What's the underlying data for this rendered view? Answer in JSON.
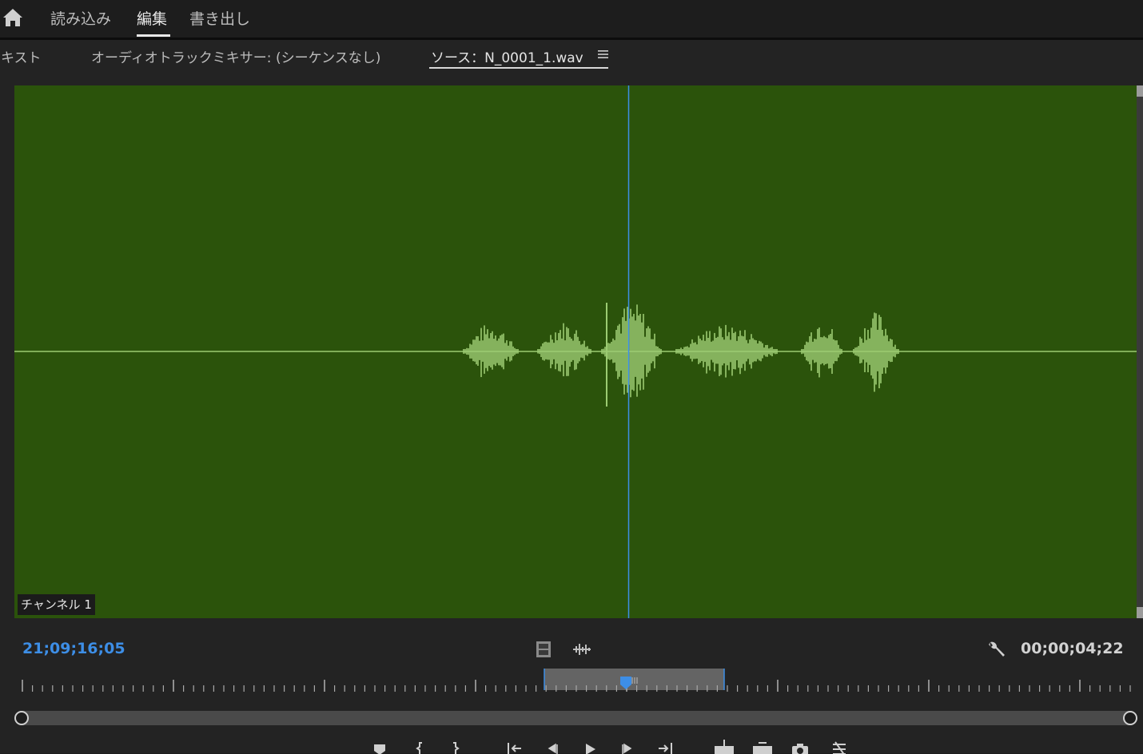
{
  "workspace_tabs": [
    {
      "label": "読み込み",
      "active": false
    },
    {
      "label": "編集",
      "active": true
    },
    {
      "label": "書き出し",
      "active": false
    }
  ],
  "panel_tabs": [
    {
      "label": "テキスト",
      "active": false
    },
    {
      "label": "オーディオトラックミキサー: (シーケンスなし)",
      "active": false
    },
    {
      "label": "ソース：N_0001_1.wav",
      "active": true
    }
  ],
  "source_monitor": {
    "channel_label": "チャンネル 1",
    "playhead_timecode": "21;09;16;05",
    "duration_timecode": "00;00;04;22"
  },
  "colors": {
    "waveform_background": "#2b530b",
    "waveform": "#9ccb72",
    "playhead": "#3d8ee6",
    "timecode_accent": "#3d8ee6"
  },
  "icons": {
    "home": "home-icon",
    "panel_menu": "hamburger-menu-icon",
    "drag_video": "film-strip-icon",
    "drag_audio": "audio-waveform-icon",
    "settings": "wrench-icon"
  },
  "transport_buttons": [
    "add-marker-icon",
    "mark-in-icon",
    "mark-out-icon",
    "go-to-in-icon",
    "step-back-icon",
    "play-icon",
    "step-forward-icon",
    "go-to-out-icon",
    "insert-icon",
    "overwrite-icon",
    "export-frame-icon",
    "button-editor-icon"
  ]
}
